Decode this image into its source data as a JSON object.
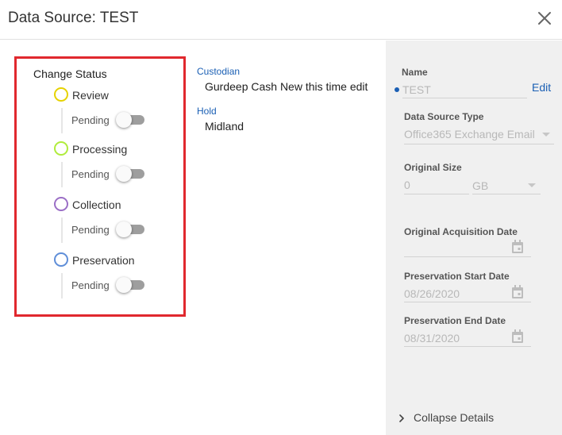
{
  "dialog": {
    "title": "Data Source: TEST"
  },
  "status": {
    "heading": "Change Status",
    "steps": [
      {
        "name": "Review",
        "state": "Pending",
        "color": "#e6d200",
        "toggled": false
      },
      {
        "name": "Processing",
        "state": "Pending",
        "color": "#b0ec3c",
        "toggled": false
      },
      {
        "name": "Collection",
        "state": "Pending",
        "color": "#9b6fc6",
        "toggled": false
      },
      {
        "name": "Preservation",
        "state": "Pending",
        "color": "#5f8ed8",
        "toggled": false
      }
    ]
  },
  "info": {
    "custodian_label": "Custodian",
    "custodian_value": "Gurdeep Cash New this time edit",
    "hold_label": "Hold",
    "hold_value": "Midland"
  },
  "details": {
    "name_label": "Name",
    "name_value": "TEST",
    "edit_label": "Edit",
    "type_label": "Data Source Type",
    "type_value": "Office365 Exchange Email",
    "size_label": "Original Size",
    "size_value": "0",
    "size_unit": "GB",
    "acq_label": "Original Acquisition Date",
    "acq_value": "",
    "pres_start_label": "Preservation Start Date",
    "pres_start_value": "08/26/2020",
    "pres_end_label": "Preservation End Date",
    "pres_end_value": "08/31/2020",
    "collapse_label": "Collapse Details"
  },
  "colors": {
    "accent": "#1a5fb4",
    "highlight_border": "#e0282e",
    "panel_bg": "#f0f0f0"
  }
}
